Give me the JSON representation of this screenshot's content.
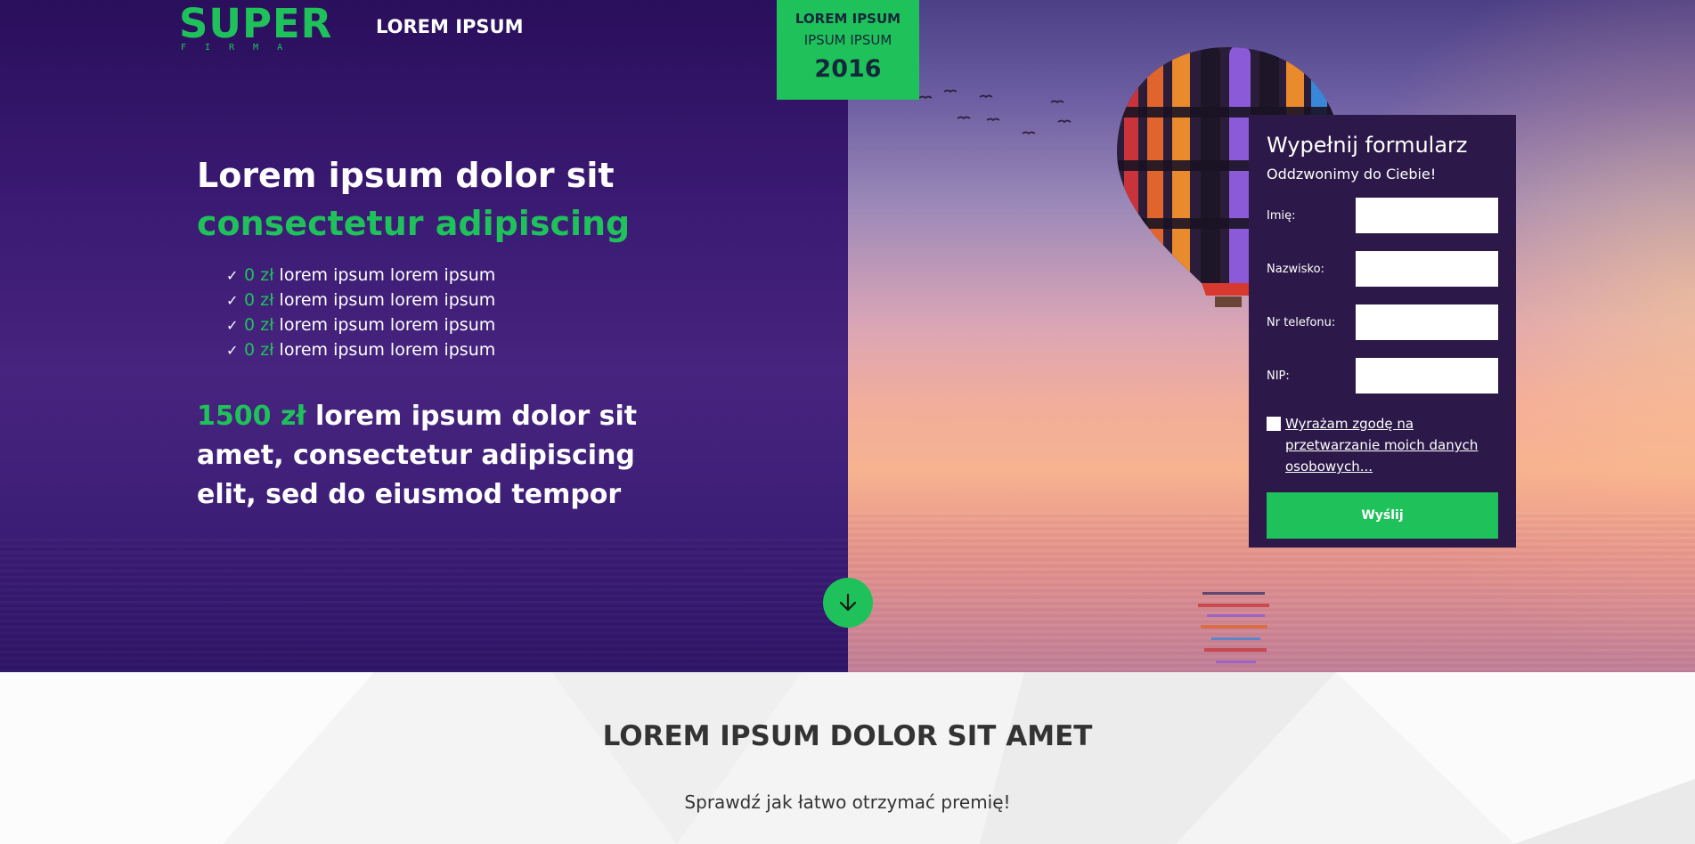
{
  "header": {
    "logo_main": "SUPER",
    "logo_sub": "FIRMA",
    "nav_link": "LOREM IPSUM"
  },
  "badge": {
    "line1": "LOREM IPSUM",
    "line2": "IPSUM IPSUM",
    "year": "2016"
  },
  "hero": {
    "headline": "Lorem ipsum dolor sit",
    "headline_accent": "consectetur adipiscing",
    "checklist": [
      {
        "price": "0 zł",
        "text": " lorem ipsum lorem ipsum"
      },
      {
        "price": "0 zł",
        "text": " lorem ipsum lorem ipsum"
      },
      {
        "price": "0 zł",
        "text": " lorem ipsum lorem ipsum"
      },
      {
        "price": "0 zł",
        "text": " lorem ipsum lorem ipsum"
      }
    ],
    "offer_price": "1500 zł",
    "offer_text": " lorem ipsum dolor sit amet, consectetur adipiscing elit, sed do eiusmod tempor"
  },
  "form": {
    "title": "Wypełnij formularz",
    "subtitle": "Oddzwonimy do Ciebie!",
    "fields": [
      {
        "label": "Imię:",
        "value": ""
      },
      {
        "label": "Nazwisko:",
        "value": ""
      },
      {
        "label": "Nr telefonu:",
        "value": ""
      },
      {
        "label": "NIP:",
        "value": ""
      }
    ],
    "consent": "Wyrażam zgodę na przetwarzanie moich danych osobowych...",
    "consent_checked": false,
    "submit": "Wyślij"
  },
  "section2": {
    "title": "LOREM IPSUM DOLOR SIT AMET",
    "subtitle": "Sprawdź jak łatwo otrzymać premię!"
  },
  "colors": {
    "accent": "#1fc15b",
    "form_bg": "#2c1949",
    "hero_purple": "#3a1a72"
  }
}
